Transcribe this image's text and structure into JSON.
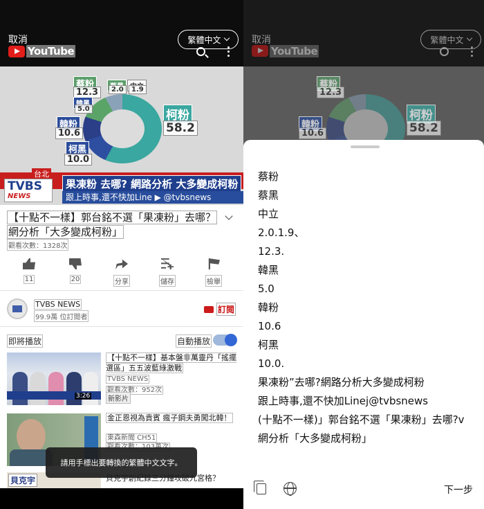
{
  "top_bar": {
    "cancel_label": "取消",
    "language_pill": "繁體中文",
    "logo_text": "YouTube"
  },
  "video_frame": {
    "labels": {
      "cai_fen": "蔡粉",
      "cai_fen_value": "12.3",
      "cai_hei": "蔡黑",
      "cai_hei_value": "2.0",
      "zhong_li": "中立",
      "zhong_li_value": "1.9",
      "han_hei": "韓黑",
      "han_hei_value": "5.0",
      "han_fen": "韓粉",
      "han_fen_value": "10.6",
      "ke_hei": "柯黑",
      "ke_hei_value": "10.0",
      "ke_fen": "柯粉",
      "ke_fen_value": "58.2"
    },
    "region_tag": "台北",
    "headline": "果凍粉 去哪? 網路分析 大多變成柯粉",
    "subline": "跟上時事,還不快加Line ▶ @tvbsnews",
    "logo_text": "TVBS",
    "logo_sub": "NEWS"
  },
  "video_info": {
    "title_line1": "【十點不一樣】郭台銘不選「果凍粉」去哪？",
    "title_line2": "網分析「大多變成柯粉」",
    "views": "觀看次數：1328次"
  },
  "actions": [
    {
      "label": "11"
    },
    {
      "label": "20"
    },
    {
      "label": "分享"
    },
    {
      "label": "儲存"
    },
    {
      "label": "檢舉"
    }
  ],
  "channel": {
    "name": "TVBS NEWS",
    "subscribers": "99.9萬 位訂閱者",
    "subscribe_label": "訂閱"
  },
  "up_next": {
    "label": "即將播放",
    "autoplay_label": "自動播放",
    "autoplay_on": true
  },
  "related": [
    {
      "title": "【十點不一樣】基本盤非萬靈丹「搖擺選區」五五波藍綠激戰",
      "channel": "TVBS NEWS",
      "views": "觀看次數：952次",
      "duration": "3:26",
      "badge": "新影片"
    },
    {
      "title": "金正恩視為貴賓 瘋子鋼夫勇闖北韓！",
      "channel": "東森新聞 CH51",
      "views": "觀看次數：103萬次"
    },
    {
      "title": "貝克宇創紀錄三分鐘攻破九宮格？",
      "thumb_text": "貝克宇"
    }
  ],
  "toast": "請用手標出要轉換的繁體中文文字。",
  "ocr_sheet": {
    "lines": [
      "蔡粉",
      "蔡黑",
      "中立",
      "2.0.1.9、",
      "12.3.",
      "韓黑",
      "5.0",
      "韓粉",
      "10.6",
      "柯黑",
      "10.0.",
      "果凍粉”去哪?網路分析大多變成柯粉",
      "跟上時事,還不快加Linej@tvbsnews",
      "(十點不一樣)」郭台銘不選「果凍粉」去哪?v",
      "網分析「大多變成柯粉」"
    ],
    "next_label": "下一步"
  }
}
